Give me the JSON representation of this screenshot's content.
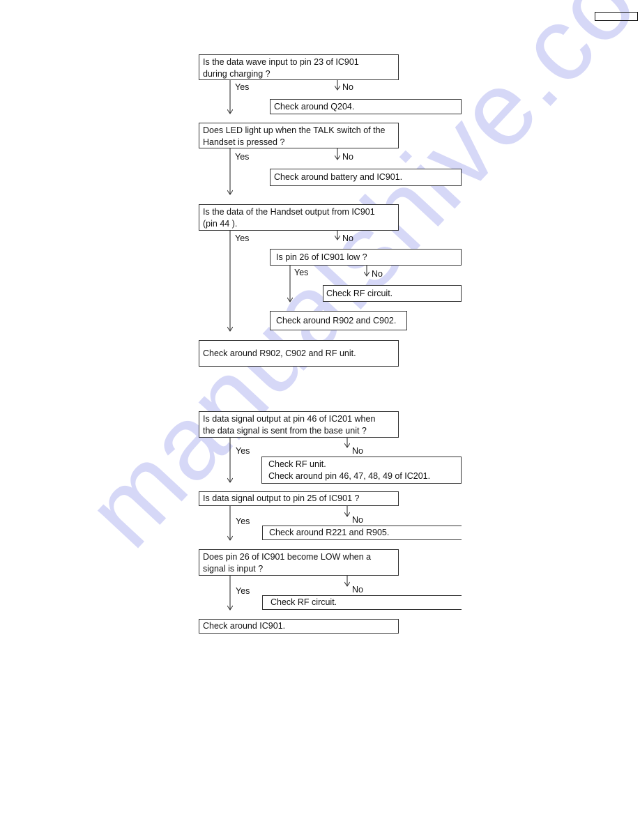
{
  "watermark": "manualshive.com",
  "flowchart_1": {
    "q1": {
      "lines": [
        "Is the data wave input to pin 23 of IC901",
        "during charging ?"
      ],
      "yes": "Yes",
      "no": "No"
    },
    "a1": "Check around Q204.",
    "q2": {
      "lines": [
        "Does LED light up when the TALK switch of the",
        "Handset is pressed ?"
      ],
      "yes": "Yes",
      "no": "No"
    },
    "a2": "Check around battery and IC901.",
    "q3": {
      "lines": [
        "Is the data of the Handset output from IC901",
        "(pin 44 )."
      ],
      "yes": "Yes",
      "no": "No"
    },
    "q4": {
      "text": "Is pin 26 of IC901 low ?",
      "yes": "Yes",
      "no": "No"
    },
    "a4_no": "Check RF circuit.",
    "a4_yes": "Check around R902 and C902.",
    "final": "Check around R902, C902 and RF unit."
  },
  "flowchart_2": {
    "q1": {
      "lines": [
        "Is data signal output at pin 46 of IC201 when",
        "the data signal is sent from the base unit ?"
      ],
      "yes": "Yes",
      "no": "No"
    },
    "a1": {
      "lines": [
        "Check RF unit.",
        "Check around pin 46, 47, 48, 49 of IC201."
      ]
    },
    "q2": {
      "text": "Is data signal output to pin 25 of IC901 ?",
      "yes": "Yes",
      "no": "No"
    },
    "a2": "Check around R221 and R905.",
    "q3": {
      "lines": [
        "Does pin 26 of IC901 become LOW when a",
        "signal is input ?"
      ],
      "yes": "Yes",
      "no": "No"
    },
    "a3": "Check RF circuit.",
    "final": "Check around IC901."
  }
}
